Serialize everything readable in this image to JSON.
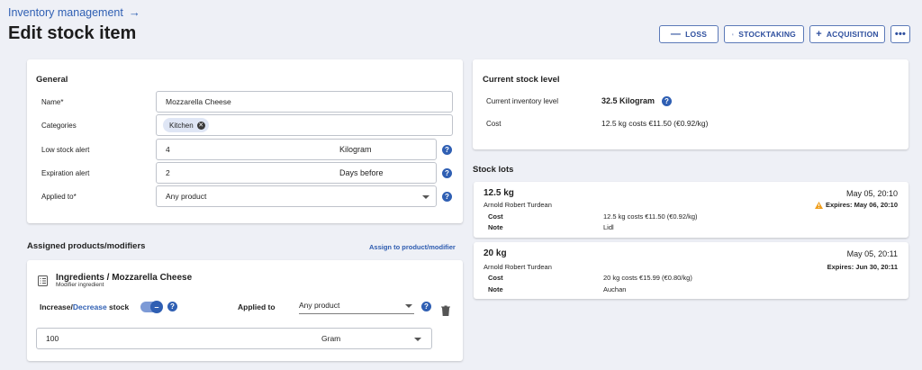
{
  "breadcrumb": {
    "label": "Inventory management",
    "arrow": "→"
  },
  "page_title": "Edit stock item",
  "toolbar": {
    "loss": "LOSS",
    "stocktaking": "STOCKTAKING",
    "acquisition": "ACQUISITION",
    "more": "•••"
  },
  "general": {
    "title": "General",
    "name_label": "Name*",
    "name_value": "Mozzarella Cheese",
    "categories_label": "Categories",
    "category_chip": "Kitchen",
    "low_stock_label": "Low stock alert",
    "low_stock_value": "4",
    "low_stock_unit": "Kilogram",
    "expiration_label": "Expiration alert",
    "expiration_value": "2",
    "expiration_unit": "Days before",
    "applied_label": "Applied to*",
    "applied_value": "Any product"
  },
  "assigned": {
    "title": "Assigned products/modifiers",
    "assign_link": "Assign to product/modifier",
    "ingredient_title": "Ingredients / Mozzarella Cheese",
    "ingredient_sub": "Modifier ingredient",
    "increase": "Increase/",
    "decrease": "Decrease",
    "stock": " stock",
    "applied_to_label": "Applied to",
    "applied_to_value": "Any product",
    "amount": "100",
    "amount_unit": "Gram"
  },
  "current_stock": {
    "title": "Current stock level",
    "inventory_label": "Current inventory level",
    "inventory_value": "32.5 Kilogram",
    "cost_label": "Cost",
    "cost_value": "12.5 kg costs €11.50 (€0.92/kg)"
  },
  "stock_lots": {
    "title": "Stock lots",
    "lots": [
      {
        "weight": "12.5 kg",
        "date": "May 05, 20:10",
        "person": "Arnold Robert Turdean",
        "expires": "Expires: May 06, 20:10",
        "warning": true,
        "cost_label": "Cost",
        "cost_value": "12.5 kg costs €11.50 (€0.92/kg)",
        "note_label": "Note",
        "note_value": "Lidl"
      },
      {
        "weight": "20 kg",
        "date": "May 05, 20:11",
        "person": "Arnold Robert Turdean",
        "expires": "Expires: Jun 30, 20:11",
        "warning": false,
        "cost_label": "Cost",
        "cost_value": "20 kg costs €15.99 (€0.80/kg)",
        "note_label": "Note",
        "note_value": "Auchan"
      }
    ]
  },
  "colors": {
    "accent": "#2f5fb3",
    "background": "#eef0f6",
    "warning": "#f0a020"
  },
  "icons": [
    "arrow-right-icon",
    "minus-icon",
    "list-icon",
    "plus-icon",
    "more-icon",
    "help-icon",
    "close-icon",
    "chevron-down-icon",
    "ingredient-icon",
    "trash-icon",
    "warning-icon",
    "toggle-check-icon"
  ]
}
